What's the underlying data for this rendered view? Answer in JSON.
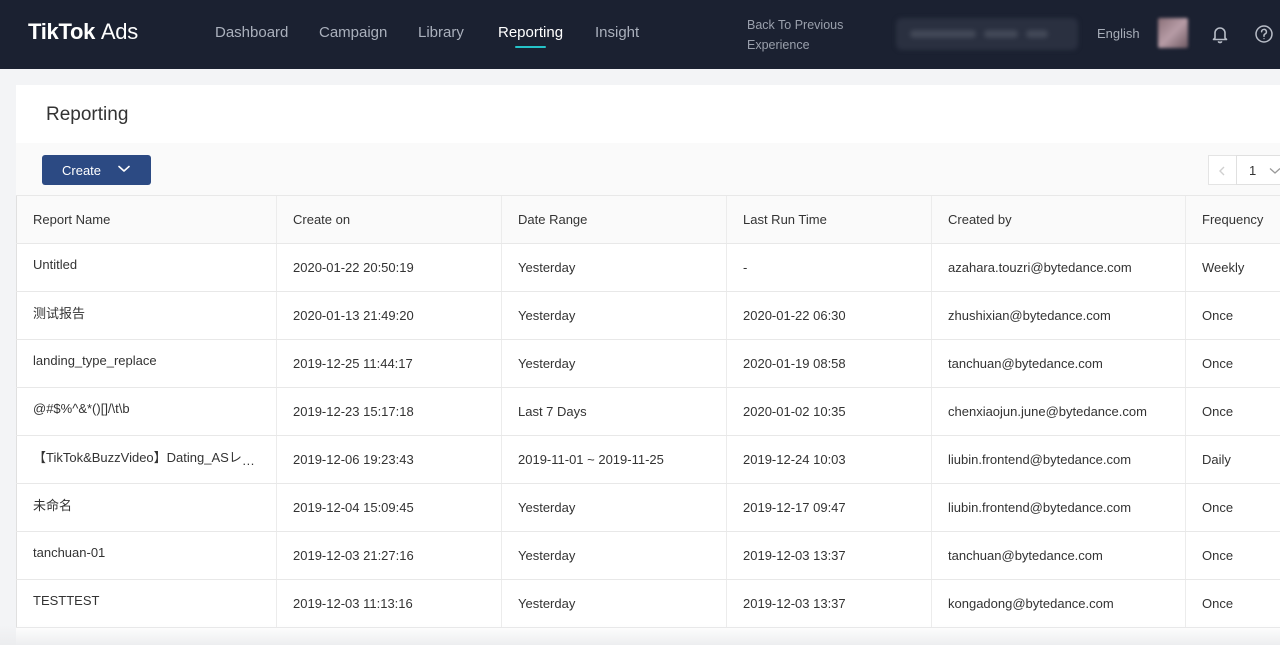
{
  "header": {
    "brand_main": "TikTok",
    "brand_suffix": "Ads",
    "nav": [
      {
        "label": "Dashboard"
      },
      {
        "label": "Campaign"
      },
      {
        "label": "Library"
      },
      {
        "label": "Reporting",
        "active": true
      },
      {
        "label": "Insight"
      }
    ],
    "back_line1": "Back To Previous",
    "back_line2": "Experience",
    "language": "English",
    "icons": [
      "bell-icon",
      "help-icon"
    ]
  },
  "page": {
    "title": "Reporting",
    "create_label": "Create",
    "pager_value": "1"
  },
  "table": {
    "columns": [
      "Report Name",
      "Create on",
      "Date Range",
      "Last Run Time",
      "Created by",
      "Frequency"
    ],
    "rows": [
      [
        "Untitled",
        "2020-01-22 20:50:19",
        "Yesterday",
        "-",
        "azahara.touzri@bytedance.com",
        "Weekly"
      ],
      [
        "测试报告",
        "2020-01-13 21:49:20",
        "Yesterday",
        "2020-01-22 06:30",
        "zhushixian@bytedance.com",
        "Once"
      ],
      [
        "landing_type_replace",
        "2019-12-25 11:44:17",
        "Yesterday",
        "2020-01-19 08:58",
        "tanchuan@bytedance.com",
        "Once"
      ],
      [
        "@#$%^&*()[]/\\t\\b",
        "2019-12-23 15:17:18",
        "Last 7 Days",
        "2020-01-02 10:35",
        "chenxiaojun.june@bytedance.com",
        "Once"
      ],
      [
        "【TikTok&BuzzVideo】Dating_ASレポ...",
        "2019-12-06 19:23:43",
        "2019-11-01 ~ 2019-11-25",
        "2019-12-24 10:03",
        "liubin.frontend@bytedance.com",
        "Daily"
      ],
      [
        "未命名",
        "2019-12-04 15:09:45",
        "Yesterday",
        "2019-12-17 09:47",
        "liubin.frontend@bytedance.com",
        "Once"
      ],
      [
        "tanchuan-01",
        "2019-12-03 21:27:16",
        "Yesterday",
        "2019-12-03 13:37",
        "tanchuan@bytedance.com",
        "Once"
      ],
      [
        "TESTTEST",
        "2019-12-03 11:13:16",
        "Yesterday",
        "2019-12-03 13:37",
        "kongadong@bytedance.com",
        "Once"
      ]
    ]
  },
  "colors": {
    "topbar": "#1b2131",
    "accent": "#25c2c8",
    "primary_button": "#2c4a83",
    "link": "#3f74c2"
  }
}
